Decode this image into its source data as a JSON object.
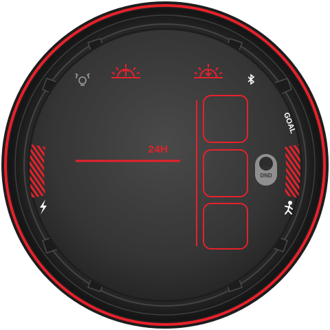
{
  "watch_face": {
    "range_label": "24H",
    "goal_label": "GOAL",
    "dnd_sleep": "zzz",
    "dnd_label": "DND"
  },
  "icons": {
    "alarm": "alarm-clock-icon",
    "sunrise": "sunrise-icon",
    "sunset": "sunset-icon",
    "bluetooth": "bluetooth-icon",
    "battery_charge": "lightning-icon",
    "steps": "walking-person-icon"
  },
  "colors": {
    "accent": "#e8212b",
    "bezel": "#2b2b2b",
    "dial": "#3b3b3b",
    "text_light": "#ffffff"
  }
}
